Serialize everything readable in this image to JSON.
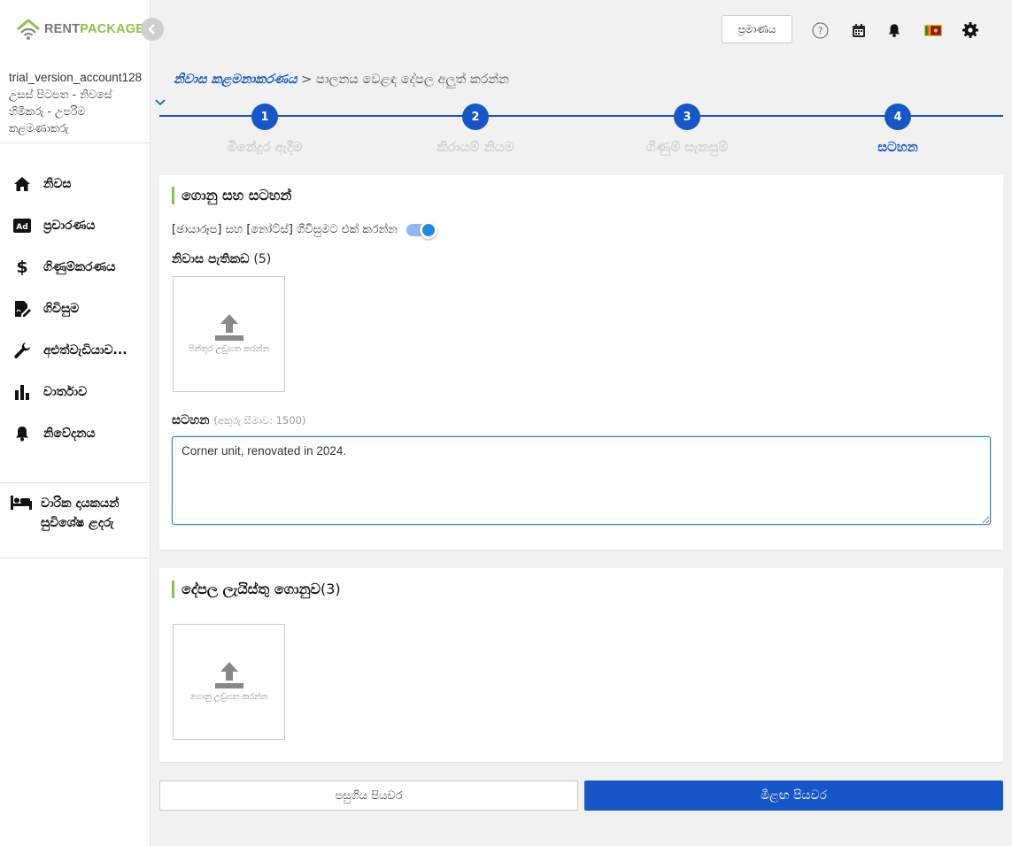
{
  "brand": {
    "name_part1": "RENT",
    "name_part2": "PACKAGE"
  },
  "account": {
    "username": "trial_version_account128",
    "role": "උසස් පිටපත - නිවසේ හිමිකරු - උපරිම කළමණාකරු"
  },
  "sidebar": {
    "items": [
      {
        "label": "නිවස",
        "icon": "home-icon"
      },
      {
        "label": "ප්‍රචාරණය",
        "icon": "ad-icon"
      },
      {
        "label": "ගිණුම්කරණය",
        "icon": "dollar-icon"
      },
      {
        "label": "ගිවිසුම",
        "icon": "contract-icon"
      },
      {
        "label": "අළුත්වැඩියාව...",
        "icon": "wrench-icon"
      },
      {
        "label": "වාර්තාව",
        "icon": "bar-chart-icon"
      },
      {
        "label": "නිවේදනය",
        "icon": "bell-icon"
      }
    ],
    "promo_label": "වාරික දායකයන් සුවිශේෂ ළදරු"
  },
  "header": {
    "auth_button": "ප්‍රමාණය"
  },
  "breadcrumb": {
    "parent": "නිවාස කළමනාකරණය",
    "separator": ">",
    "current": "පාලනය වෙළඳ දේපල අලුත් කරන්න"
  },
  "stepper": {
    "steps": [
      {
        "number": "1",
        "label": "මිනේදුර ඇදීම"
      },
      {
        "number": "2",
        "label": "කිරායම් නියම"
      },
      {
        "number": "3",
        "label": "ගිණුම් සැකසුම්"
      },
      {
        "number": "4",
        "label": "සටහන"
      }
    ],
    "active_step": 4
  },
  "files_notes": {
    "title": "ගොනු සහ සටහන්",
    "toggle_label": "[ඡායාරූප] සහ [නෝට්ස්] ගිවිසුමට එක් කරන්න",
    "toggle_on": true,
    "photos_label": "නිවාස පැතිකඩ",
    "photos_count": "(5)",
    "upload_image_label": "පින්තූර උඩුගත කරන්න",
    "notes_label": "සටහන",
    "notes_limit": "(අකුරු සීමාව: 1500)",
    "notes_value": "Corner unit, renovated in 2024."
  },
  "property_files": {
    "title": "දේපල ලැයිස්තු ගොනුව",
    "count": "(3)",
    "upload_file_label": "ගොනු උඩුගත කරන්න"
  },
  "buttons": {
    "prev": "පසුගිය පියවර",
    "next": "මීළඟ පියවර"
  },
  "colors": {
    "primary": "#1656c9",
    "accent_green": "#8bc34a",
    "toggle_blue": "#1e88e5"
  }
}
